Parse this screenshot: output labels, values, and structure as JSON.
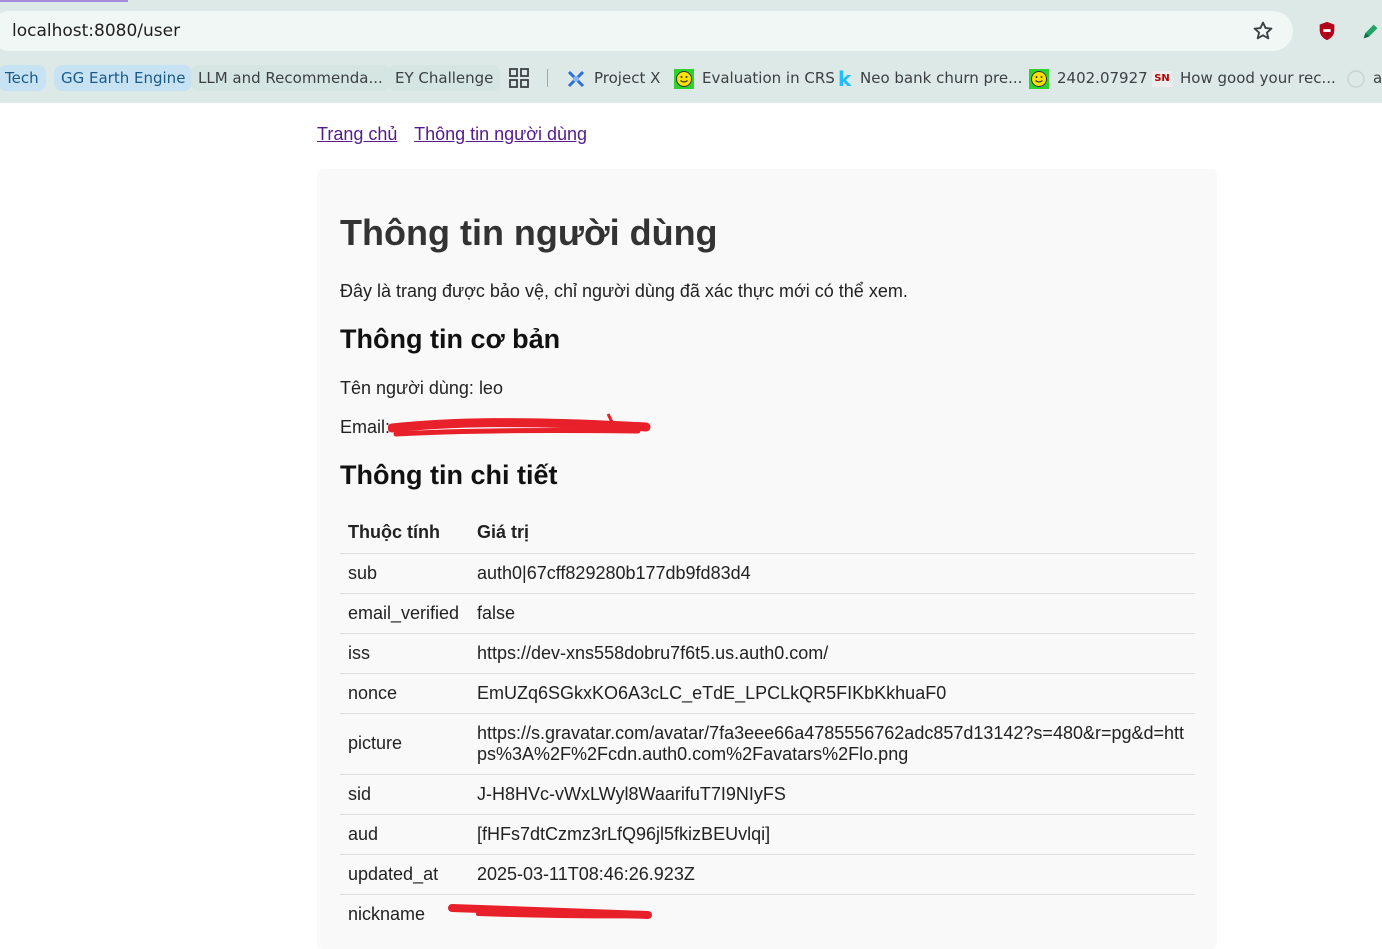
{
  "browser": {
    "url": "localhost:8080/user",
    "bookmarks": [
      {
        "label": "Tech",
        "icon": "group-chip"
      },
      {
        "label": "GG Earth Engine",
        "icon": "group-chip"
      },
      {
        "label": "LLM and Recommenda...",
        "icon": "group-chip"
      },
      {
        "label": "EY Challenge",
        "icon": "group-chip"
      },
      {
        "label": "",
        "icon": "apps-grid-icon"
      },
      {
        "label": "Project X",
        "icon": "projectx-icon"
      },
      {
        "label": "Evaluation in CRS",
        "icon": "smiley-icon"
      },
      {
        "label": "Neo bank churn pre...",
        "icon": "kaggle-k-icon"
      },
      {
        "label": "2402.07927",
        "icon": "smiley-icon"
      },
      {
        "label": "How good your rec...",
        "icon": "sn-icon"
      },
      {
        "label": "ar",
        "icon": "github-icon"
      }
    ]
  },
  "nav": {
    "home": "Trang chủ",
    "user_info": "Thông tin người dùng"
  },
  "page": {
    "title": "Thông tin người dùng",
    "intro": "Đây là trang được bảo vệ, chỉ người dùng đã xác thực mới có thể xem.",
    "basic_heading": "Thông tin cơ bản",
    "username_line": "Tên người dùng: leo",
    "email_label": "Email:",
    "detail_heading": "Thông tin chi tiết"
  },
  "table": {
    "headers": [
      "Thuộc tính",
      "Giá trị"
    ],
    "rows": [
      {
        "key": "sub",
        "value": "auth0|67cff829280b177db9fd83d4"
      },
      {
        "key": "email_verified",
        "value": "false"
      },
      {
        "key": "iss",
        "value": "https://dev-xns558dobru7f6t5.us.auth0.com/"
      },
      {
        "key": "nonce",
        "value": "EmUZq6SGkxKO6A3cLC_eTdE_LPCLkQR5FIKbKkhuaF0"
      },
      {
        "key": "picture",
        "value": "https://s.gravatar.com/avatar/7fa3eee66a4785556762adc857d13142?s=480&r=pg&d=https%3A%2F%2Fcdn.auth0.com%2Favatars%2Flo.png"
      },
      {
        "key": "sid",
        "value": "J-H8HVc-vWxLWyl8WaarifuT7I9NIyFS"
      },
      {
        "key": "aud",
        "value": "[fHFs7dtCzmz3rLfQ96jl5fkizBEUvlqi]"
      },
      {
        "key": "updated_at",
        "value": "2025-03-11T08:46:26.923Z"
      },
      {
        "key": "nickname",
        "value": ""
      }
    ]
  },
  "colors": {
    "chrome_bg": "#dde9e6",
    "link_visited": "#551a8b",
    "redaction": "#e8202a",
    "card_bg": "#f9f9f9"
  }
}
